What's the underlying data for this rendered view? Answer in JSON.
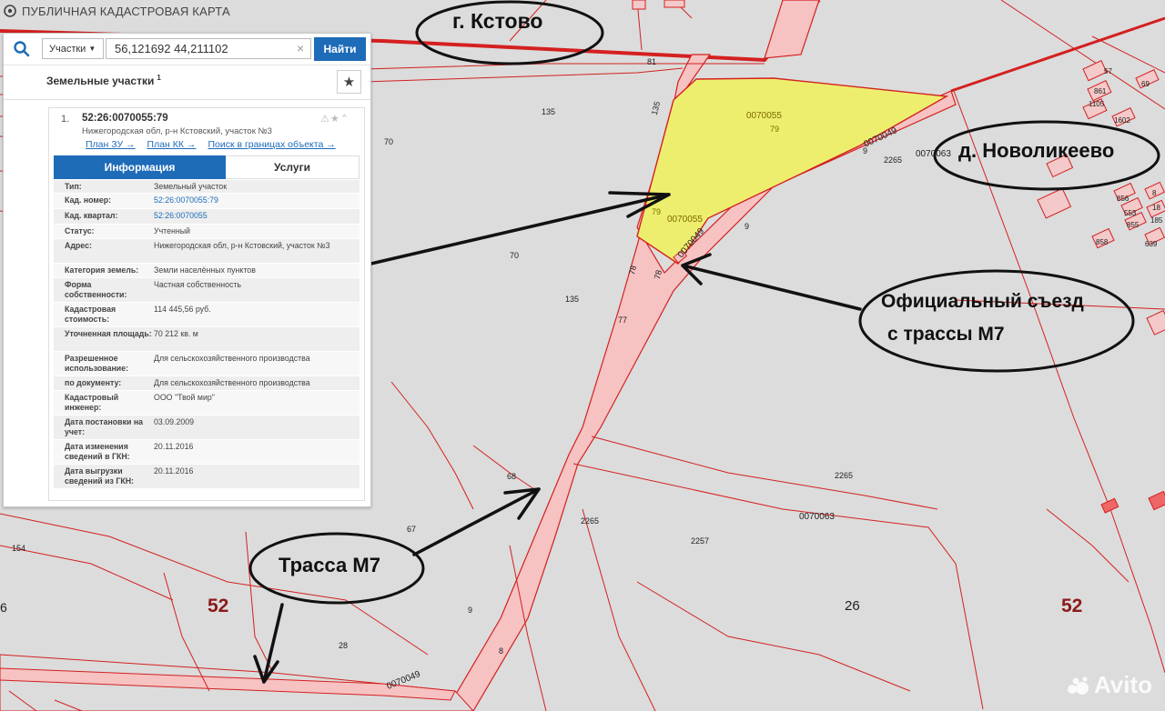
{
  "app": {
    "title": "ПУБЛИЧНАЯ КАДАСТРОВАЯ КАРТА"
  },
  "search": {
    "type_label": "Участки",
    "query": "56,121692 44,211102",
    "button_label": "Найти"
  },
  "results": {
    "title": "Земельные участки",
    "count": "1"
  },
  "card": {
    "index": "1.",
    "cad_number": "52:26:0070055:79",
    "address": "Нижегородская обл, р-н Кстовский, участок №3",
    "links": [
      "План ЗУ →",
      "План КК →",
      "Поиск в границах объекта →"
    ],
    "tabs": [
      "Информация",
      "Услуги"
    ],
    "rows": [
      {
        "label": "Тип:",
        "value": "Земельный участок"
      },
      {
        "label": "Кад. номер:",
        "value": "52:26:0070055:79"
      },
      {
        "label": "Кад. квартал:",
        "value": "52:26:0070055"
      },
      {
        "label": "Статус:",
        "value": "Учтенный"
      },
      {
        "label": "Адрес:",
        "value": "Нижегородская обл, р-н Кстовский, участок №3"
      },
      {
        "label": "Категория земель:",
        "value": "Земли населённых пунктов"
      },
      {
        "label": "Форма собственности:",
        "value": "Частная собственность"
      },
      {
        "label": "Кадастровая стоимость:",
        "value": "114 445,56 руб."
      },
      {
        "label": "Уточненная площадь:",
        "value": "70 212 кв. м"
      },
      {
        "label": "Разрешенное использование:",
        "value": "Для сельскохозяйственного производства"
      },
      {
        "label": "по документу:",
        "value": "Для сельскохозяйственного производства"
      },
      {
        "label": "Кадастровый инженер:",
        "value": "ООО \"Твой мир\""
      },
      {
        "label": "Дата постановки на учет:",
        "value": "03.09.2009"
      },
      {
        "label": "Дата изменения сведений в ГКН:",
        "value": "20.11.2016"
      },
      {
        "label": "Дата выгрузки сведений из ГКН:",
        "value": "20.11.2016"
      }
    ]
  },
  "annotations": {
    "kstovo": "г. Кстово",
    "novolikeevo": "д. Новоликеево",
    "exit_line1": "Официальный съезд",
    "exit_line2": "с трассы М7",
    "highway": "Трасса М7"
  },
  "map_labels": {
    "parcel_a": "0070055",
    "parcel_a_num": "79",
    "parcel_b": "0070055",
    "quarter_49a": "0070049",
    "quarter_49b": "0070049",
    "quarter_49c": "0070049",
    "quarter_63a": "0070063",
    "quarter_63b": "0070063",
    "region_left": "52",
    "region_right": "52",
    "n26": "26",
    "n81": "81",
    "n135a": "135",
    "n135b": "135",
    "n135c": "135",
    "n70a": "70",
    "n70b": "70",
    "n78a": "78",
    "n78b": "78",
    "n77": "77",
    "n79": "79",
    "n9a": "9",
    "n9b": "9",
    "n9c": "9",
    "n2265a": "2265",
    "n2265b": "2265",
    "n2265c": "2265",
    "n2257": "2257",
    "n68": "68",
    "n67": "67",
    "n154": "154",
    "n28": "28",
    "n8": "8",
    "n6": "6",
    "n57": "57",
    "n861": "861",
    "n1105": "1105",
    "n1602": "1602",
    "n856": "856",
    "n553": "553",
    "n855": "855",
    "n858": "858",
    "n639": "639",
    "n8b": "8",
    "n18": "18",
    "n185": "185",
    "n69": "69"
  },
  "watermark": "Avito",
  "colors": {
    "map_bg": "#dcdcdc",
    "boundary": "#d42020",
    "road": "#f4b4b4",
    "parcel_fill": "#eeee6e",
    "accent": "#1e6bb8",
    "region": "#8b1a1a"
  }
}
